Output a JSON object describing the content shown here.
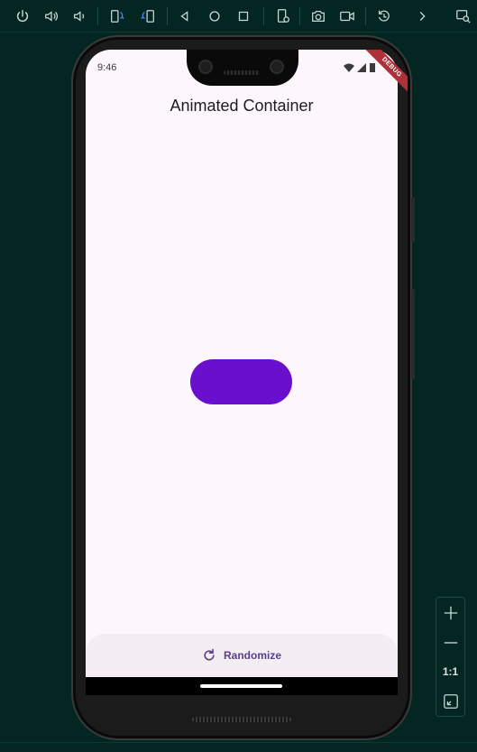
{
  "emulator": {
    "toolbar": [
      {
        "name": "power-button",
        "icon": "power-icon"
      },
      {
        "name": "volume-up-button",
        "icon": "volume-up-icon"
      },
      {
        "name": "volume-down-button",
        "icon": "volume-down-icon"
      },
      {
        "name": "rotate-left-button",
        "icon": "rotate-left-icon"
      },
      {
        "name": "rotate-right-button",
        "icon": "rotate-right-icon"
      },
      {
        "name": "back-button",
        "icon": "back-triangle-icon"
      },
      {
        "name": "home-button",
        "icon": "home-circle-icon"
      },
      {
        "name": "overview-button",
        "icon": "overview-square-icon"
      },
      {
        "name": "fold-button",
        "icon": "device-settings-icon"
      },
      {
        "name": "screenshot-button",
        "icon": "camera-icon"
      },
      {
        "name": "record-button",
        "icon": "video-icon"
      },
      {
        "name": "snapshot-button",
        "icon": "restore-icon"
      },
      {
        "name": "more-button",
        "icon": "chevron-right-icon"
      },
      {
        "name": "device-mirror-button",
        "icon": "mirror-search-icon"
      }
    ],
    "zoom": {
      "zoom_in_icon": "plus-icon",
      "zoom_out_icon": "minus-icon",
      "actual_size_label": "1:1",
      "fit_icon": "fit-screen-icon"
    },
    "colors": {
      "background": "#042622",
      "icon": "#c9d8d6",
      "accent": "#4b8bf5"
    }
  },
  "device": {
    "status_bar": {
      "time": "9:46",
      "icons": [
        "wifi-icon",
        "signal-icon",
        "battery-icon"
      ]
    },
    "debug_banner": "DEBUG"
  },
  "app": {
    "title": "Animated Container",
    "animated_container": {
      "color": "#6a0fce"
    },
    "bottom_button": {
      "label": "Randomize",
      "icon": "refresh-icon"
    },
    "colors": {
      "background": "#fdf7fd",
      "bottom_bar": "#f4eef4",
      "label": "#5a3f8a"
    }
  }
}
